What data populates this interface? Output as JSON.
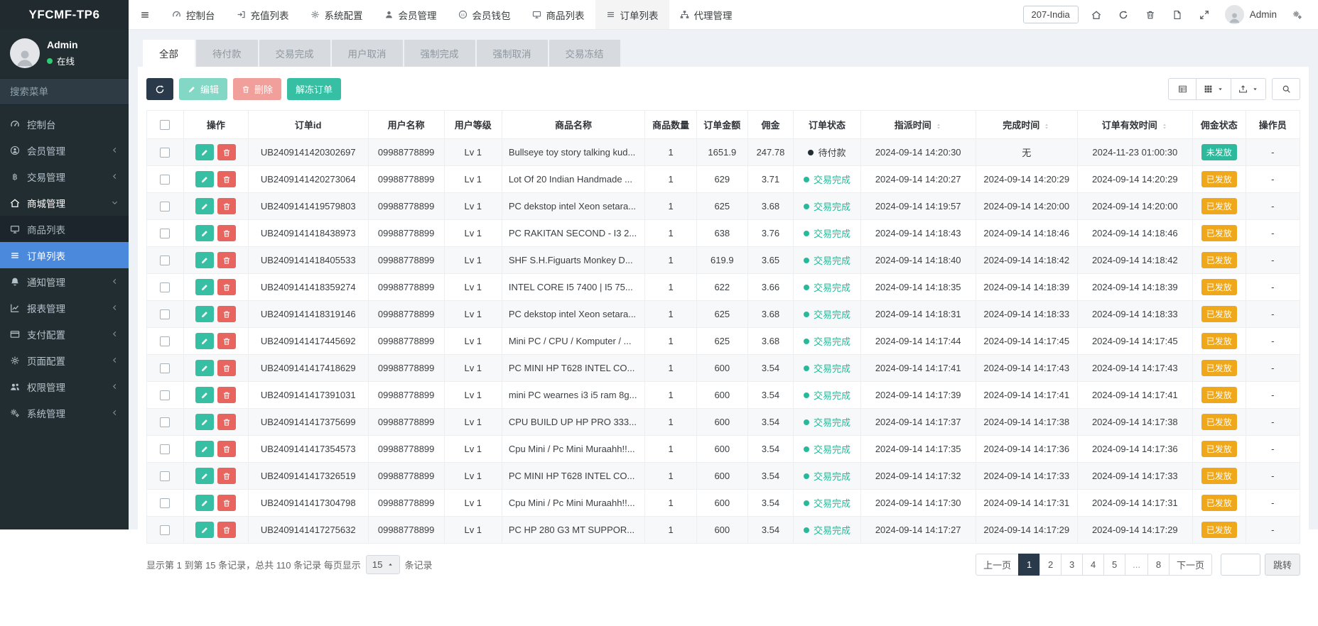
{
  "colors": {
    "accent_blue": "#4a89dc",
    "green": "#36bfa2",
    "red": "#e8655f",
    "orange": "#efa71c",
    "teal_badge": "#2cb99c",
    "navy": "#2b3a4a",
    "status_green": "#26b99a",
    "sidebar_bg": "#222d32",
    "online_green": "#2ecc71",
    "page_bg": "#eef1f5"
  },
  "brand": "YFCMF-TP6",
  "user_panel": {
    "name": "Admin",
    "status": "在线"
  },
  "sidebar": {
    "search_placeholder": "搜索菜单",
    "items": [
      {
        "name": "dashboard",
        "label": "控制台",
        "icon": "gauge",
        "expandable": false
      },
      {
        "name": "member",
        "label": "会员管理",
        "icon": "user-circle",
        "expandable": true
      },
      {
        "name": "trade",
        "label": "交易管理",
        "icon": "btc",
        "expandable": true
      },
      {
        "name": "mall",
        "label": "商城管理",
        "icon": "home",
        "expandable": true,
        "expanded": true,
        "children": [
          {
            "name": "product-list",
            "label": "商品列表",
            "icon": "monitor",
            "active": false
          },
          {
            "name": "order-list",
            "label": "订单列表",
            "icon": "bars",
            "active": true
          }
        ]
      },
      {
        "name": "notice",
        "label": "通知管理",
        "icon": "bell",
        "expandable": true
      },
      {
        "name": "report",
        "label": "报表管理",
        "icon": "chart",
        "expandable": true
      },
      {
        "name": "payment",
        "label": "支付配置",
        "icon": "card",
        "expandable": true
      },
      {
        "name": "page",
        "label": "页面配置",
        "icon": "gear",
        "expandable": true
      },
      {
        "name": "permission",
        "label": "权限管理",
        "icon": "users",
        "expandable": true
      },
      {
        "name": "system",
        "label": "系统管理",
        "icon": "cogs",
        "expandable": true
      }
    ]
  },
  "topnav": {
    "items": [
      {
        "name": "dashboard",
        "label": "控制台",
        "icon": "gauge",
        "active": false
      },
      {
        "name": "recharge-list",
        "label": "充值列表",
        "icon": "signin",
        "active": false
      },
      {
        "name": "system-config",
        "label": "系统配置",
        "icon": "gear",
        "active": false
      },
      {
        "name": "member-management",
        "label": "会员管理",
        "icon": "user",
        "active": false
      },
      {
        "name": "member-wallet",
        "label": "会员钱包",
        "icon": "wallet",
        "active": false
      },
      {
        "name": "product-list",
        "label": "商品列表",
        "icon": "monitor",
        "active": false
      },
      {
        "name": "order-list",
        "label": "订单列表",
        "icon": "bars",
        "active": true
      },
      {
        "name": "agent-management",
        "label": "代理管理",
        "icon": "sitemap",
        "active": false
      }
    ],
    "region": "207-India",
    "username": "Admin"
  },
  "tabs": {
    "active": 0,
    "items": [
      {
        "name": "all",
        "label": "全部"
      },
      {
        "name": "pending-payment",
        "label": "待付款"
      },
      {
        "name": "trade-complete",
        "label": "交易完成"
      },
      {
        "name": "user-cancel",
        "label": "用户取消"
      },
      {
        "name": "force-complete",
        "label": "强制完成"
      },
      {
        "name": "force-cancel",
        "label": "强制取消"
      },
      {
        "name": "trade-frozen",
        "label": "交易冻结"
      }
    ]
  },
  "toolbar": {
    "edit_label": "编辑",
    "delete_label": "删除",
    "unfreeze_label": "解冻订单"
  },
  "table": {
    "columns": [
      {
        "label": "操作"
      },
      {
        "label": "订单id"
      },
      {
        "label": "用户名称"
      },
      {
        "label": "用户等级"
      },
      {
        "label": "商品名称"
      },
      {
        "label": "商品数量"
      },
      {
        "label": "订单金额"
      },
      {
        "label": "佣金"
      },
      {
        "label": "订单状态"
      },
      {
        "label": "指派时间",
        "sortable": true
      },
      {
        "label": "完成时间",
        "sortable": true
      },
      {
        "label": "订单有效时间",
        "sortable": true
      },
      {
        "label": "佣金状态"
      },
      {
        "label": "操作员"
      }
    ],
    "rows": [
      {
        "id": "UB2409141420302697",
        "user": "09988778899",
        "level": "Lv 1",
        "product": "Bullseye toy story talking kud...",
        "qty": "1",
        "amount": "1651.9",
        "commission": "247.78",
        "status": "待付款",
        "status_type": "pending",
        "assign_time": "2024-09-14 14:20:30",
        "finish_time": "无",
        "valid_time": "2024-11-23 01:00:30",
        "comm_status": "未发放",
        "comm_status_type": "unreleased",
        "operator": "-"
      },
      {
        "id": "UB2409141420273064",
        "user": "09988778899",
        "level": "Lv 1",
        "product": "Lot Of 20 Indian Handmade ...",
        "qty": "1",
        "amount": "629",
        "commission": "3.71",
        "status": "交易完成",
        "status_type": "done",
        "assign_time": "2024-09-14 14:20:27",
        "finish_time": "2024-09-14 14:20:29",
        "valid_time": "2024-09-14 14:20:29",
        "comm_status": "已发放",
        "comm_status_type": "released",
        "operator": "-"
      },
      {
        "id": "UB2409141419579803",
        "user": "09988778899",
        "level": "Lv 1",
        "product": "PC dekstop intel Xeon setara...",
        "qty": "1",
        "amount": "625",
        "commission": "3.68",
        "status": "交易完成",
        "status_type": "done",
        "assign_time": "2024-09-14 14:19:57",
        "finish_time": "2024-09-14 14:20:00",
        "valid_time": "2024-09-14 14:20:00",
        "comm_status": "已发放",
        "comm_status_type": "released",
        "operator": "-"
      },
      {
        "id": "UB2409141418438973",
        "user": "09988778899",
        "level": "Lv 1",
        "product": "PC RAKITAN SECOND - I3 2...",
        "qty": "1",
        "amount": "638",
        "commission": "3.76",
        "status": "交易完成",
        "status_type": "done",
        "assign_time": "2024-09-14 14:18:43",
        "finish_time": "2024-09-14 14:18:46",
        "valid_time": "2024-09-14 14:18:46",
        "comm_status": "已发放",
        "comm_status_type": "released",
        "operator": "-"
      },
      {
        "id": "UB2409141418405533",
        "user": "09988778899",
        "level": "Lv 1",
        "product": "SHF S.H.Figuarts Monkey D...",
        "qty": "1",
        "amount": "619.9",
        "commission": "3.65",
        "status": "交易完成",
        "status_type": "done",
        "assign_time": "2024-09-14 14:18:40",
        "finish_time": "2024-09-14 14:18:42",
        "valid_time": "2024-09-14 14:18:42",
        "comm_status": "已发放",
        "comm_status_type": "released",
        "operator": "-"
      },
      {
        "id": "UB2409141418359274",
        "user": "09988778899",
        "level": "Lv 1",
        "product": "INTEL CORE I5 7400 | I5 75...",
        "qty": "1",
        "amount": "622",
        "commission": "3.66",
        "status": "交易完成",
        "status_type": "done",
        "assign_time": "2024-09-14 14:18:35",
        "finish_time": "2024-09-14 14:18:39",
        "valid_time": "2024-09-14 14:18:39",
        "comm_status": "已发放",
        "comm_status_type": "released",
        "operator": "-"
      },
      {
        "id": "UB2409141418319146",
        "user": "09988778899",
        "level": "Lv 1",
        "product": "PC dekstop intel Xeon setara...",
        "qty": "1",
        "amount": "625",
        "commission": "3.68",
        "status": "交易完成",
        "status_type": "done",
        "assign_time": "2024-09-14 14:18:31",
        "finish_time": "2024-09-14 14:18:33",
        "valid_time": "2024-09-14 14:18:33",
        "comm_status": "已发放",
        "comm_status_type": "released",
        "operator": "-"
      },
      {
        "id": "UB2409141417445692",
        "user": "09988778899",
        "level": "Lv 1",
        "product": "Mini PC / CPU / Komputer / ...",
        "qty": "1",
        "amount": "625",
        "commission": "3.68",
        "status": "交易完成",
        "status_type": "done",
        "assign_time": "2024-09-14 14:17:44",
        "finish_time": "2024-09-14 14:17:45",
        "valid_time": "2024-09-14 14:17:45",
        "comm_status": "已发放",
        "comm_status_type": "released",
        "operator": "-"
      },
      {
        "id": "UB2409141417418629",
        "user": "09988778899",
        "level": "Lv 1",
        "product": "PC MINI HP T628 INTEL CO...",
        "qty": "1",
        "amount": "600",
        "commission": "3.54",
        "status": "交易完成",
        "status_type": "done",
        "assign_time": "2024-09-14 14:17:41",
        "finish_time": "2024-09-14 14:17:43",
        "valid_time": "2024-09-14 14:17:43",
        "comm_status": "已发放",
        "comm_status_type": "released",
        "operator": "-"
      },
      {
        "id": "UB2409141417391031",
        "user": "09988778899",
        "level": "Lv 1",
        "product": "mini PC wearnes i3 i5 ram 8g...",
        "qty": "1",
        "amount": "600",
        "commission": "3.54",
        "status": "交易完成",
        "status_type": "done",
        "assign_time": "2024-09-14 14:17:39",
        "finish_time": "2024-09-14 14:17:41",
        "valid_time": "2024-09-14 14:17:41",
        "comm_status": "已发放",
        "comm_status_type": "released",
        "operator": "-"
      },
      {
        "id": "UB2409141417375699",
        "user": "09988778899",
        "level": "Lv 1",
        "product": "CPU BUILD UP HP PRO 333...",
        "qty": "1",
        "amount": "600",
        "commission": "3.54",
        "status": "交易完成",
        "status_type": "done",
        "assign_time": "2024-09-14 14:17:37",
        "finish_time": "2024-09-14 14:17:38",
        "valid_time": "2024-09-14 14:17:38",
        "comm_status": "已发放",
        "comm_status_type": "released",
        "operator": "-"
      },
      {
        "id": "UB2409141417354573",
        "user": "09988778899",
        "level": "Lv 1",
        "product": "Cpu Mini / Pc Mini Muraahh!!...",
        "qty": "1",
        "amount": "600",
        "commission": "3.54",
        "status": "交易完成",
        "status_type": "done",
        "assign_time": "2024-09-14 14:17:35",
        "finish_time": "2024-09-14 14:17:36",
        "valid_time": "2024-09-14 14:17:36",
        "comm_status": "已发放",
        "comm_status_type": "released",
        "operator": "-"
      },
      {
        "id": "UB2409141417326519",
        "user": "09988778899",
        "level": "Lv 1",
        "product": "PC MINI HP T628 INTEL CO...",
        "qty": "1",
        "amount": "600",
        "commission": "3.54",
        "status": "交易完成",
        "status_type": "done",
        "assign_time": "2024-09-14 14:17:32",
        "finish_time": "2024-09-14 14:17:33",
        "valid_time": "2024-09-14 14:17:33",
        "comm_status": "已发放",
        "comm_status_type": "released",
        "operator": "-"
      },
      {
        "id": "UB2409141417304798",
        "user": "09988778899",
        "level": "Lv 1",
        "product": "Cpu Mini / Pc Mini Muraahh!!...",
        "qty": "1",
        "amount": "600",
        "commission": "3.54",
        "status": "交易完成",
        "status_type": "done",
        "assign_time": "2024-09-14 14:17:30",
        "finish_time": "2024-09-14 14:17:31",
        "valid_time": "2024-09-14 14:17:31",
        "comm_status": "已发放",
        "comm_status_type": "released",
        "operator": "-"
      },
      {
        "id": "UB2409141417275632",
        "user": "09988778899",
        "level": "Lv 1",
        "product": "PC HP 280 G3 MT SUPPOR...",
        "qty": "1",
        "amount": "600",
        "commission": "3.54",
        "status": "交易完成",
        "status_type": "done",
        "assign_time": "2024-09-14 14:17:27",
        "finish_time": "2024-09-14 14:17:29",
        "valid_time": "2024-09-14 14:17:29",
        "comm_status": "已发放",
        "comm_status_type": "released",
        "operator": "-"
      }
    ]
  },
  "pagination": {
    "info_prefix": "显示第 1 到第 15 条记录，总共 110 条记录 每页显示",
    "page_size": "15",
    "info_suffix": "条记录",
    "active_page": "1",
    "pages": [
      {
        "name": "prev",
        "label": "上一页"
      },
      {
        "name": "page-1",
        "label": "1"
      },
      {
        "name": "page-2",
        "label": "2"
      },
      {
        "name": "page-3",
        "label": "3"
      },
      {
        "name": "page-4",
        "label": "4"
      },
      {
        "name": "page-5",
        "label": "5"
      },
      {
        "name": "ellipsis",
        "label": "..."
      },
      {
        "name": "page-8",
        "label": "8"
      },
      {
        "name": "next",
        "label": "下一页"
      }
    ],
    "jump_label": "跳转"
  }
}
